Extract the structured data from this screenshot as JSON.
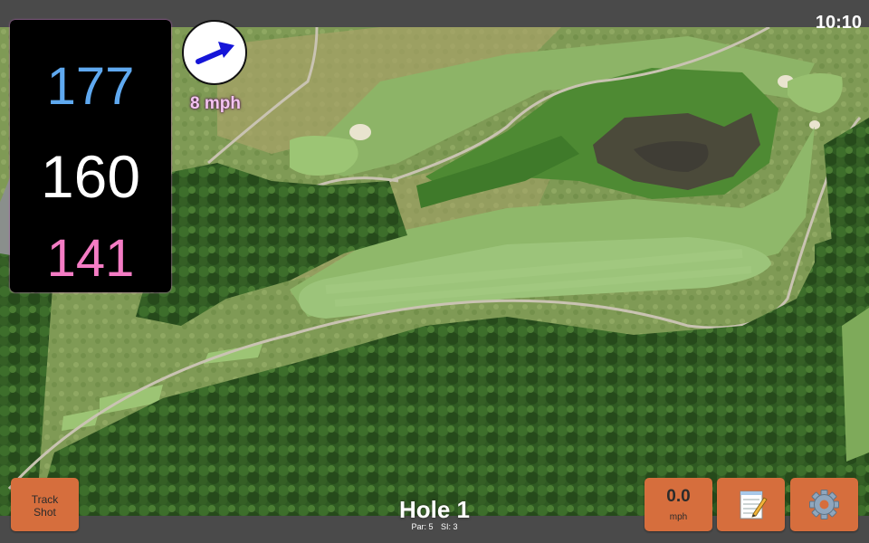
{
  "status_bar": {
    "time": "10:10"
  },
  "distances": {
    "back": "177",
    "middle": "160",
    "front": "141"
  },
  "wind": {
    "speed": "8 mph",
    "icon": "wind-direction-arrow-icon"
  },
  "hole": {
    "title": "Hole 1",
    "par": "Par: 5",
    "stroke_index": "SI: 3"
  },
  "buttons": {
    "track_shot_line1": "Track",
    "track_shot_line2": "Shot",
    "speed_value": "0.0",
    "speed_unit": "mph",
    "notes_icon": "notepad-icon",
    "settings_icon": "gear-icon"
  },
  "colors": {
    "back_distance": "#5fa9f0",
    "middle_distance": "#ffffff",
    "front_distance": "#f47cc4",
    "button": "#d66e3d"
  }
}
